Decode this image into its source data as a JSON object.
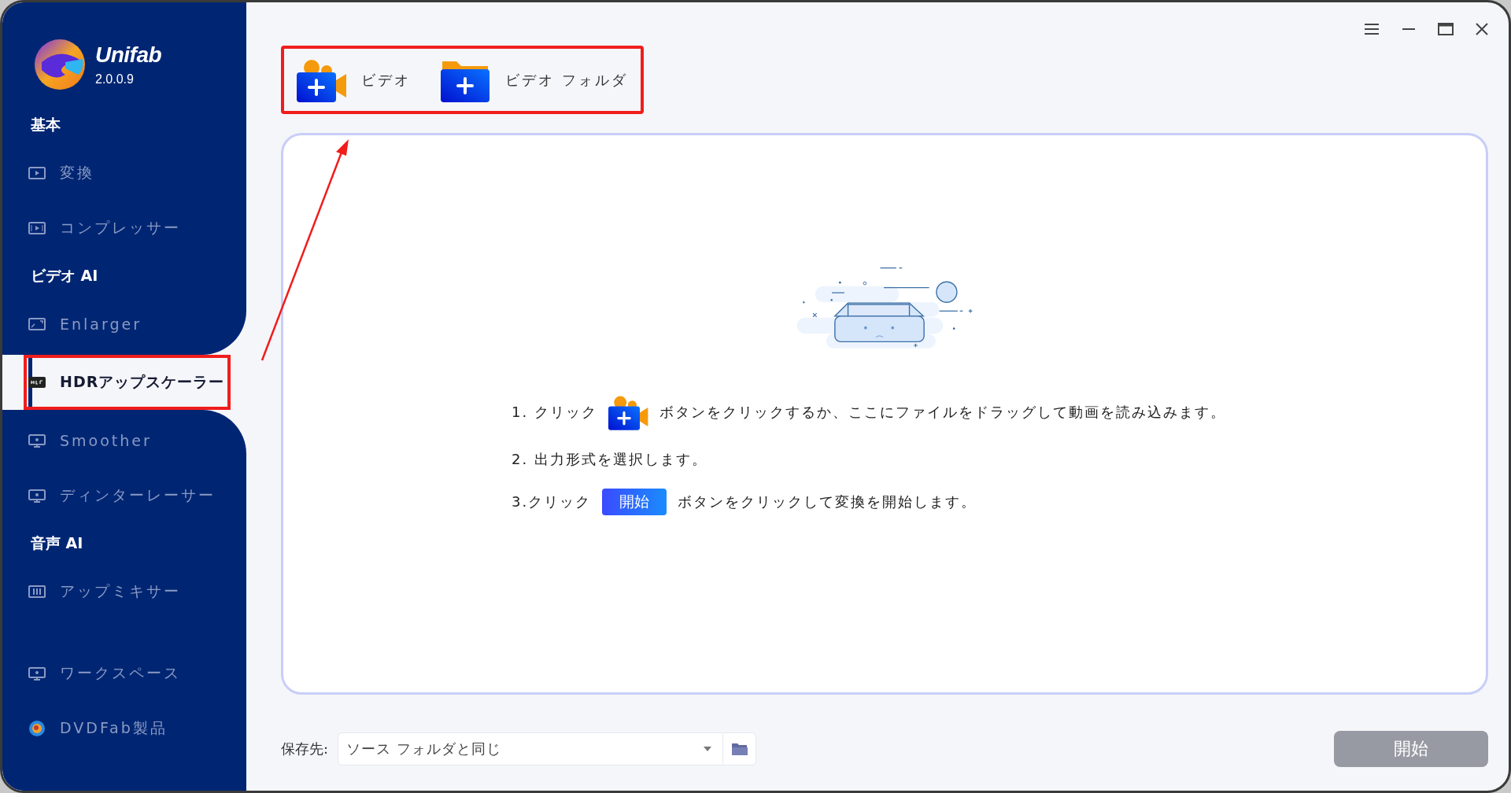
{
  "app": {
    "name": "Unifab",
    "version": "2.0.0.9"
  },
  "sidebar": {
    "entries": [
      {
        "kind": "heading",
        "label": "基本"
      },
      {
        "kind": "item",
        "label": "変換",
        "selected": false
      },
      {
        "kind": "item",
        "label": "コンプレッサー",
        "selected": false
      },
      {
        "kind": "heading",
        "label": "ビデオ AI"
      },
      {
        "kind": "item",
        "label": "Enlarger",
        "selected": false
      },
      {
        "kind": "item",
        "label": "HDRアップスケーラー",
        "selected": true
      },
      {
        "kind": "item",
        "label": "Smoother",
        "selected": false
      },
      {
        "kind": "item",
        "label": "ディンターレーサー",
        "selected": false
      },
      {
        "kind": "heading",
        "label": "音声 AI"
      },
      {
        "kind": "item",
        "label": "アップミキサー",
        "selected": false
      }
    ],
    "footer": [
      {
        "label": "ワークスペース"
      },
      {
        "label": "DVDFab製品"
      }
    ]
  },
  "toolbar": [
    {
      "kind": "video",
      "label": "ビデオ"
    },
    {
      "kind": "folder",
      "label": "ビデオ フォルダ"
    }
  ],
  "instructions": [
    {
      "kind": "icon",
      "before": "1. クリック",
      "after": "ボタンをクリックするか、ここにファイルをドラッグして動画を読み込みます。"
    },
    {
      "kind": "text",
      "before": "2. 出力形式を選択します。"
    },
    {
      "kind": "badge",
      "before": "3.クリック",
      "badge": "開始",
      "after": "ボタンをクリックして変換を開始します。"
    }
  ],
  "save": {
    "label": "保存先:",
    "value": "ソース フォルダと同じ"
  },
  "start_button": {
    "label": "開始",
    "disabled": true
  },
  "annotations": {
    "toolbar_box": true,
    "selected_box": true,
    "arrow": true
  }
}
